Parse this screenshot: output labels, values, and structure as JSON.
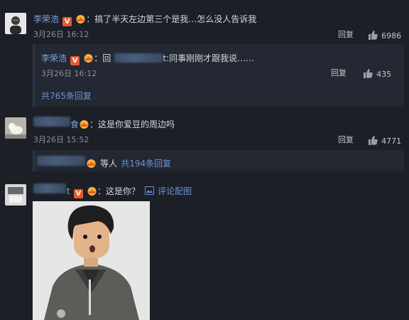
{
  "colors": {
    "bg": "#1c1f26",
    "name": "#7ea3e0",
    "link": "#6d93d8",
    "accent": "#e8582c"
  },
  "comment1": {
    "author": "李荣浩",
    "text": "：搞了半天左边第三个是我…怎么没人告诉我",
    "time": "3月26日 16:12",
    "reply_label": "回复",
    "likes": "6986",
    "sub_reply": {
      "author": "李荣浩",
      "prefix": "：回",
      "text": "t:同事刚刚才跟我说……",
      "time": "3月26日 16:12",
      "reply_label": "回复",
      "likes": "435"
    },
    "total_replies": "共765条回复"
  },
  "comment2": {
    "author_suffix": "食",
    "text": "：这是你爱豆的周边吗",
    "time": "3月26日 15:52",
    "reply_label": "回复",
    "likes": "4771",
    "others_text": "等人",
    "total_replies": "共194条回复"
  },
  "comment3": {
    "author_suffix": "t",
    "text": "：这是你？",
    "image_link": "评论配图"
  }
}
